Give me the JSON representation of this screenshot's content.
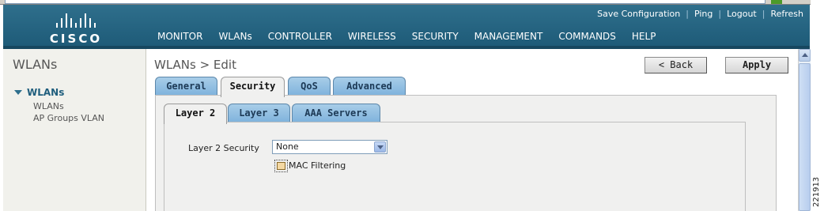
{
  "header": {
    "logo_text": "CISCO",
    "top_links": [
      "Save Configuration",
      "Ping",
      "Logout",
      "Refresh"
    ],
    "menu": [
      "MONITOR",
      "WLANs",
      "CONTROLLER",
      "WIRELESS",
      "SECURITY",
      "MANAGEMENT",
      "COMMANDS",
      "HELP"
    ],
    "active_menu": "WLANs"
  },
  "sidebar": {
    "title": "WLANs",
    "group_label": "WLANs",
    "items": [
      "WLANs",
      "AP Groups VLAN"
    ]
  },
  "content": {
    "title": "WLANs > Edit",
    "back_label": "< Back",
    "apply_label": "Apply",
    "tabs": [
      "General",
      "Security",
      "QoS",
      "Advanced"
    ],
    "active_tab": "Security",
    "subtabs": [
      "Layer 2",
      "Layer 3",
      "AAA Servers"
    ],
    "active_subtab": "Layer 2",
    "form": {
      "layer2_label": "Layer 2 Security",
      "layer2_value": "None",
      "mac_filtering_label": "MAC Filtering",
      "mac_filtering_checked": false
    }
  },
  "figure_id": "221913",
  "colors": {
    "header": "#1d5a77",
    "menu_underline": "#f2a024",
    "tab": "#7eb2dc",
    "panel": "#f0f0ef"
  }
}
